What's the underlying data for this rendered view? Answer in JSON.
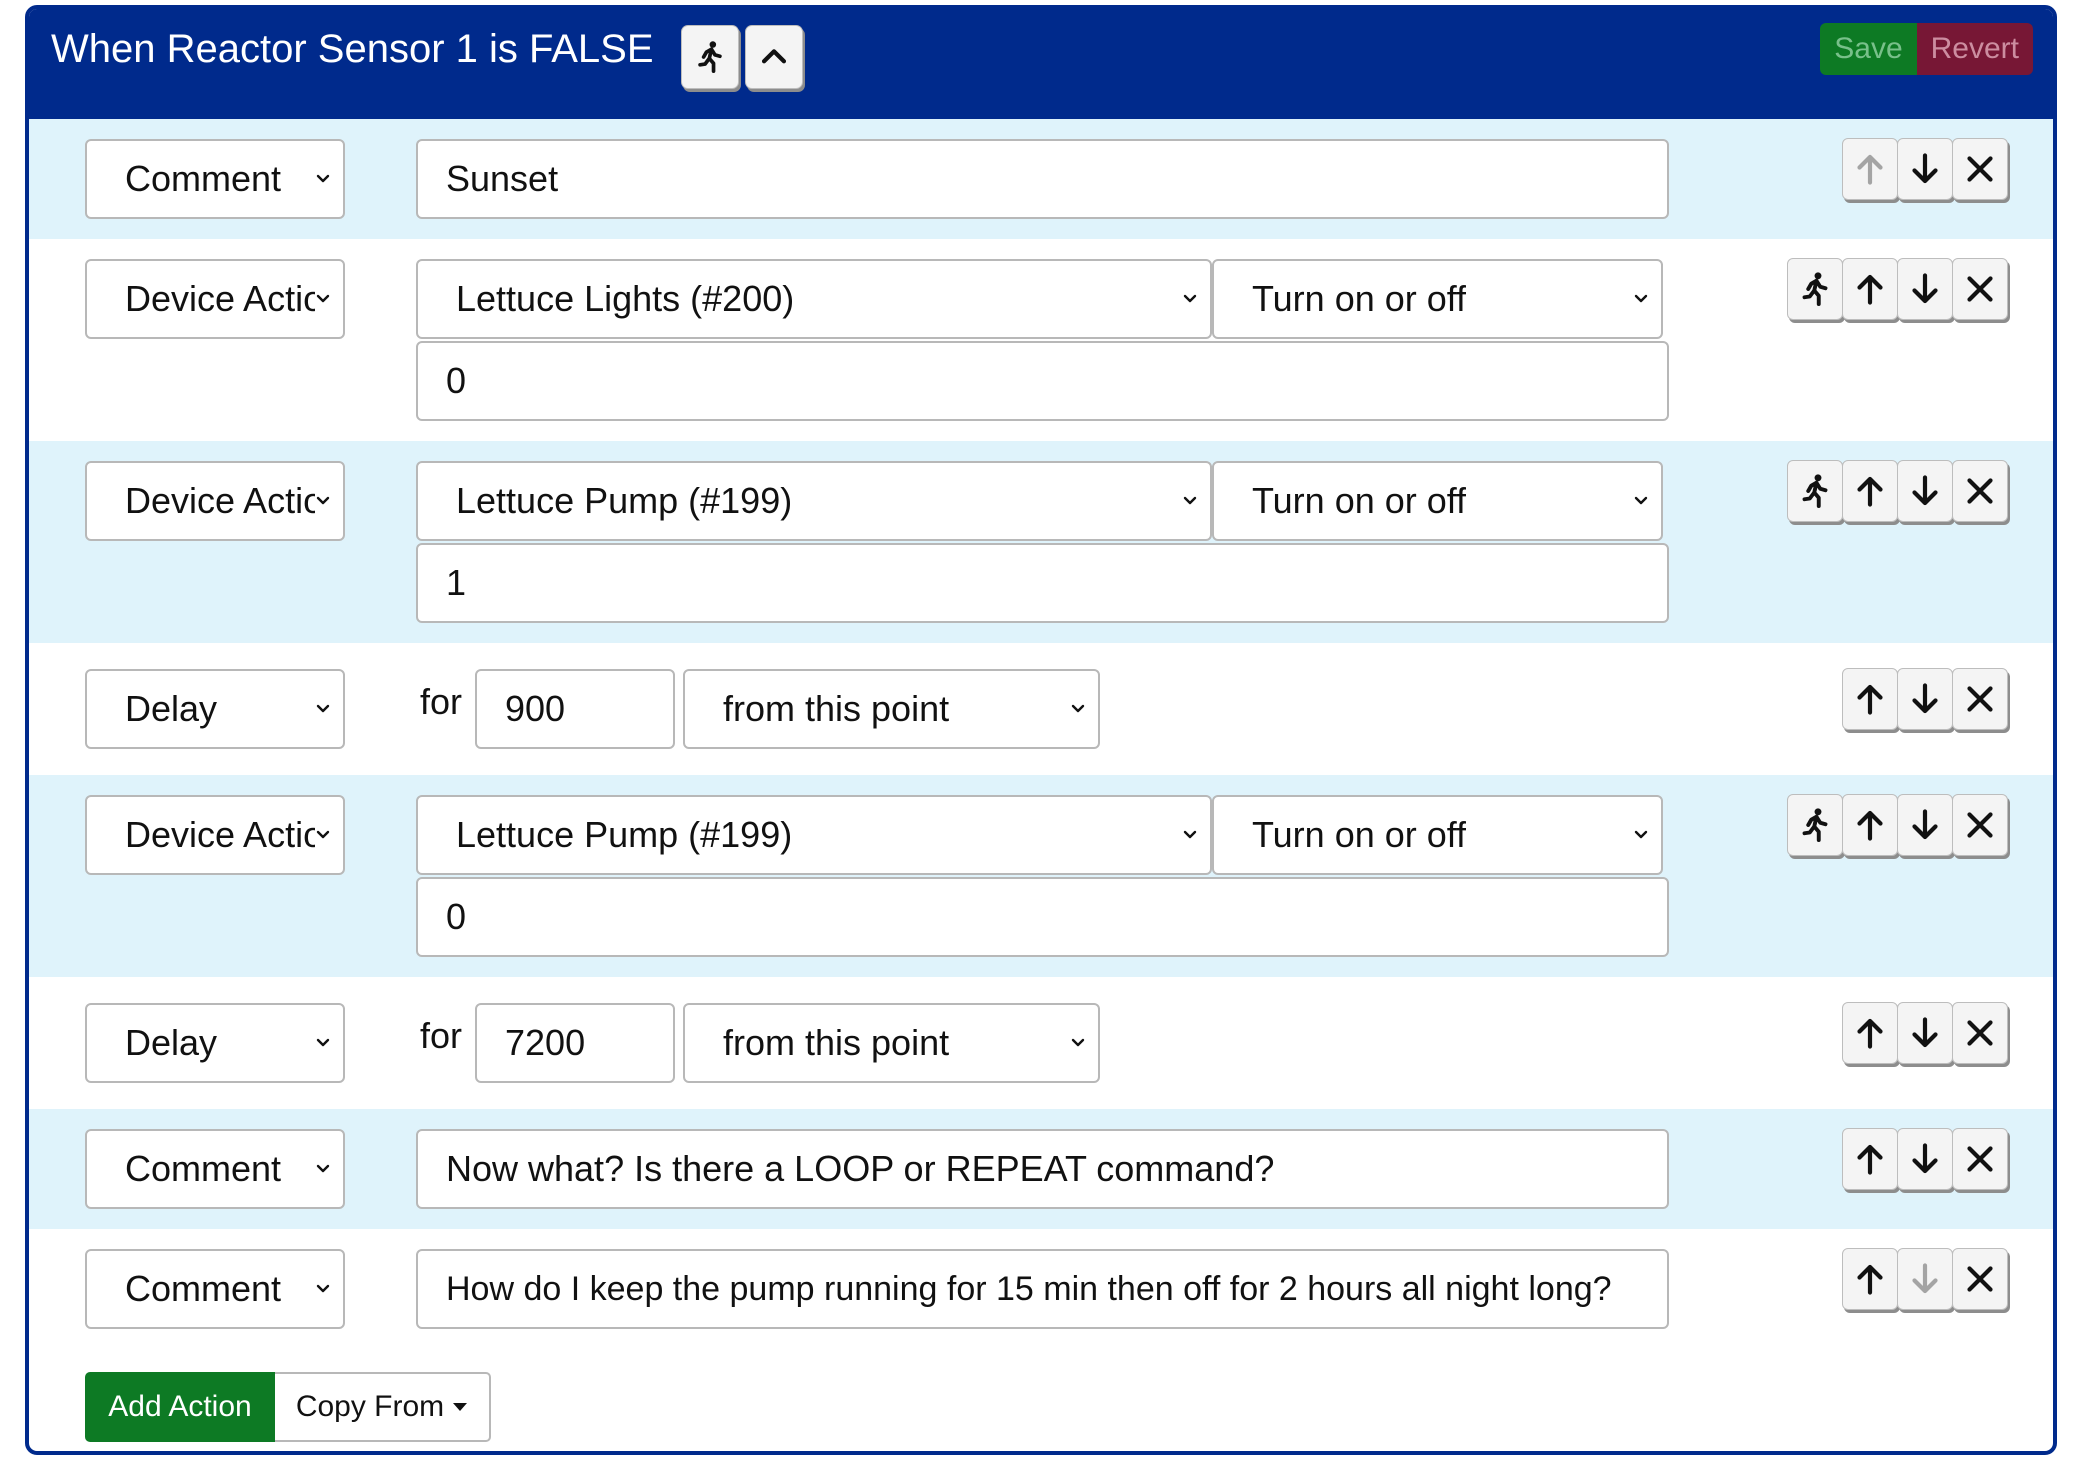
{
  "header": {
    "title": "When Reactor Sensor 1 is FALSE",
    "save_label": "Save",
    "revert_label": "Revert",
    "run_icon": "run-icon",
    "collapse_icon": "chevron-up-icon"
  },
  "actions": [
    {
      "type": "Comment",
      "text": "Sunset"
    },
    {
      "type": "Device Action",
      "device": "Lettuce Lights (#200)",
      "action": "Turn on or off",
      "value": "0"
    },
    {
      "type": "Device Action",
      "device": "Lettuce Pump (#199)",
      "action": "Turn on or off",
      "value": "1"
    },
    {
      "type": "Delay",
      "for_label": "for",
      "seconds": "900",
      "mode": "from this point"
    },
    {
      "type": "Device Action",
      "device": "Lettuce Pump (#199)",
      "action": "Turn on or off",
      "value": "0"
    },
    {
      "type": "Delay",
      "for_label": "for",
      "seconds": "7200",
      "mode": "from this point"
    },
    {
      "type": "Comment",
      "text": "Now what?  Is there a LOOP or REPEAT command?"
    },
    {
      "type": "Comment",
      "text": "How do I keep the pump running for 15 min then off for 2 hours all night long?"
    }
  ],
  "footer": {
    "add_action_label": "Add Action",
    "copy_from_label": "Copy From"
  },
  "colors": {
    "header_bg": "#002a8c",
    "row_alt_bg": "#dff3fb",
    "save_bg": "#0d7a24",
    "revert_bg": "#771735",
    "add_action_bg": "#0d7a24"
  }
}
